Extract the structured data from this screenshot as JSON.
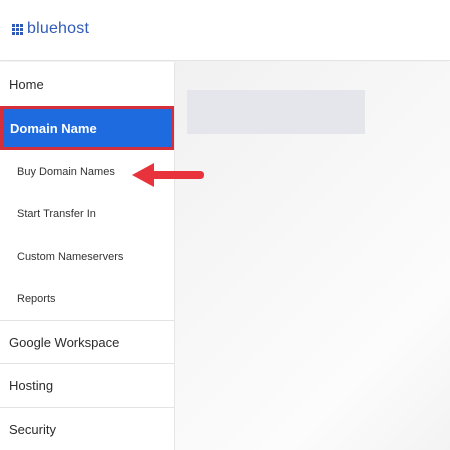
{
  "brand": {
    "name": "bluehost",
    "color": "#2f5bb7"
  },
  "sidebar": {
    "home": "Home",
    "domain_name": "Domain Name",
    "buy_domain_names": "Buy Domain Names",
    "start_transfer_in": "Start Transfer In",
    "custom_nameservers": "Custom Nameservers",
    "reports": "Reports",
    "google_workspace": "Google Workspace",
    "hosting": "Hosting",
    "security": "Security"
  },
  "colors": {
    "active_bg": "#1e6be0",
    "highlight_border": "#d42f3a",
    "arrow": "#e8323c"
  },
  "icons": {
    "logo": "grid-logo-icon",
    "pointer": "left-arrow-icon"
  }
}
